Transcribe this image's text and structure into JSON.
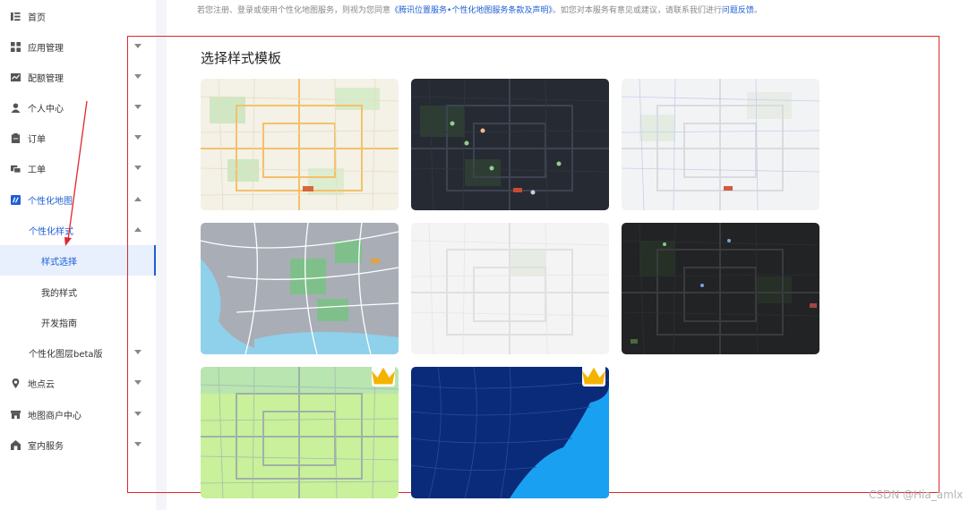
{
  "notice": {
    "text_before": "若您注册、登录或使用个性化地图服务，则视为您同意",
    "terms_link": "《腾讯位置服务•个性化地图服务条款及声明》",
    "text_middle": "。如您对本服务有意见或建议，请联系我们进行",
    "feedback_link": "问题反馈",
    "text_end": "。"
  },
  "sidebar": {
    "items": [
      {
        "label": "首页",
        "icon": "home-list-icon"
      },
      {
        "label": "应用管理",
        "icon": "grid-icon"
      },
      {
        "label": "配额管理",
        "icon": "chart-icon"
      },
      {
        "label": "个人中心",
        "icon": "user-icon"
      },
      {
        "label": "订单",
        "icon": "clipboard-icon"
      },
      {
        "label": "工单",
        "icon": "ticket-icon"
      },
      {
        "label": "个性化地图",
        "icon": "map-style-icon"
      },
      {
        "label": "个性化样式"
      },
      {
        "label": "样式选择"
      },
      {
        "label": "我的样式"
      },
      {
        "label": "开发指南"
      },
      {
        "label": "个性化图层beta版"
      },
      {
        "label": "地点云",
        "icon": "location-pin-icon"
      },
      {
        "label": "地图商户中心",
        "icon": "store-icon"
      },
      {
        "label": "室内服务",
        "icon": "indoor-icon"
      }
    ]
  },
  "main": {
    "section_title": "选择样式模板",
    "templates": [
      {
        "name": "classic",
        "premium": false
      },
      {
        "name": "dark-night",
        "premium": false
      },
      {
        "name": "light-gray",
        "premium": false
      },
      {
        "name": "coastal-city",
        "premium": false
      },
      {
        "name": "minimal-white",
        "premium": false
      },
      {
        "name": "black-dark",
        "premium": false
      },
      {
        "name": "green-fresh",
        "premium": true
      },
      {
        "name": "deep-blue",
        "premium": true
      }
    ]
  },
  "watermark": "CSDN @Hia_amlx",
  "colors": {
    "accent": "#1f5fd6",
    "annotation_red": "#e0262b",
    "crown": "#f5b301"
  }
}
